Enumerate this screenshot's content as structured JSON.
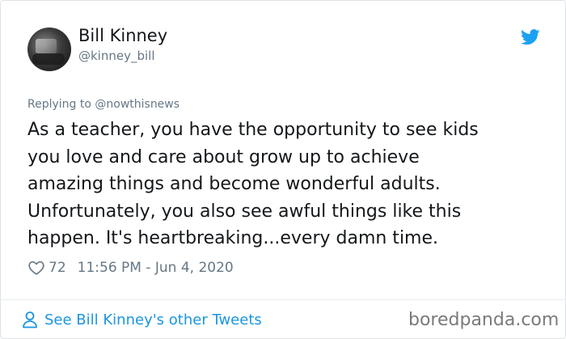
{
  "author": {
    "display_name": "Bill Kinney",
    "handle": "@kinney_bill"
  },
  "reply_context": "Replying to @nowthisnews",
  "tweet": {
    "lines": [
      "As a teacher, you have the opportunity to see kids",
      "you love and care about grow up to achieve",
      "amazing things and become wonderful adults.",
      "Unfortunately, you also see awful things like this",
      "happen. It's heartbreaking...every damn time."
    ],
    "likes": "72",
    "timestamp": "11:56 PM - Jun 4, 2020"
  },
  "footer": {
    "see_more_label": "See Bill Kinney's other Tweets"
  },
  "watermark": "boredpanda.com",
  "icons": {
    "brand": "twitter-bird-icon",
    "like": "heart-outline-icon",
    "profile": "person-outline-icon"
  },
  "colors": {
    "text": "#14171a",
    "muted": "#657786",
    "link": "#1b95e0",
    "twitter_blue": "#1da1f2"
  }
}
